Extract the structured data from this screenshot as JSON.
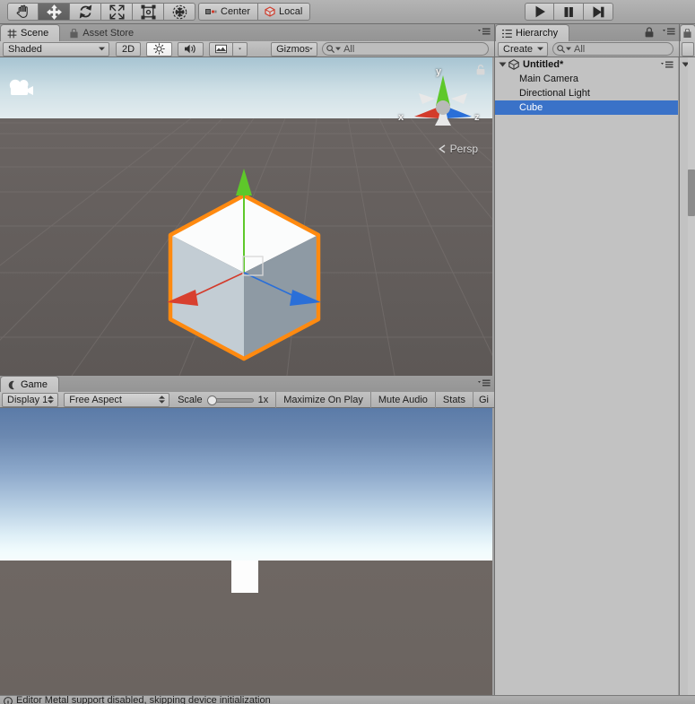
{
  "toolbar": {
    "transform_tools": [
      {
        "name": "hand-tool",
        "icon": "hand-icon",
        "active": false
      },
      {
        "name": "move-tool",
        "icon": "move-arrows-icon",
        "active": true
      },
      {
        "name": "rotate-tool",
        "icon": "rotate-icon",
        "active": false
      },
      {
        "name": "scale-tool",
        "icon": "scale-icon",
        "active": false
      },
      {
        "name": "rect-tool",
        "icon": "rect-transform-icon",
        "active": false
      },
      {
        "name": "transform-tool",
        "icon": "transform-combined-icon",
        "active": false
      }
    ],
    "pivot_mode_label": "Center",
    "pivot_rotation_label": "Local",
    "playback": [
      {
        "name": "play-button",
        "icon": "play-icon"
      },
      {
        "name": "pause-button",
        "icon": "pause-icon"
      },
      {
        "name": "step-button",
        "icon": "step-forward-icon"
      }
    ]
  },
  "scene_panel": {
    "tabs": [
      {
        "label": "Scene",
        "icon": "grid-icon",
        "active": true
      },
      {
        "label": "Asset Store",
        "icon": "store-bag-icon",
        "active": false
      }
    ],
    "draw_mode_label": "Shaded",
    "mode_2d_label": "2D",
    "lighting_icon": "sun-icon",
    "audio_icon": "speaker-icon",
    "effects_icon": "image-icon",
    "gizmos_label": "Gizmos",
    "search_placeholder": "All",
    "gizmo_axes": {
      "x": "x",
      "y": "y",
      "z": "z"
    },
    "projection_label": "Persp",
    "lock_icon": "lock-icon",
    "camera_gizmo_icon": "camera-icon",
    "selection_outline_color": "#ff8a10",
    "axis_colors": {
      "x": "#d33b2b",
      "y": "#5ec82a",
      "z": "#2a6fd8"
    }
  },
  "game_panel": {
    "tab_label": "Game",
    "tab_icon": "game-moon-icon",
    "display_label": "Display 1",
    "aspect_label": "Free Aspect",
    "scale_label": "Scale",
    "scale_value": "1x",
    "maximize_label": "Maximize On Play",
    "mute_label": "Mute Audio",
    "stats_label": "Stats",
    "gizmos_label": "Gi"
  },
  "hierarchy": {
    "tab_label": "Hierarchy",
    "tab_icon": "hierarchy-list-icon",
    "lock_icon": "lock-icon",
    "menu_icon": "hamburger-menu-icon",
    "create_label": "Create",
    "search_placeholder": "All",
    "scene_name": "Untitled*",
    "scene_icon": "unity-scene-icon",
    "items": [
      {
        "label": "Main Camera",
        "selected": false
      },
      {
        "label": "Directional Light",
        "selected": false
      },
      {
        "label": "Cube",
        "selected": true
      }
    ],
    "selection_color": "#3a72c8"
  },
  "status_bar": {
    "icon": "info-icon",
    "message": "Editor Metal support disabled, skipping device initialization"
  }
}
